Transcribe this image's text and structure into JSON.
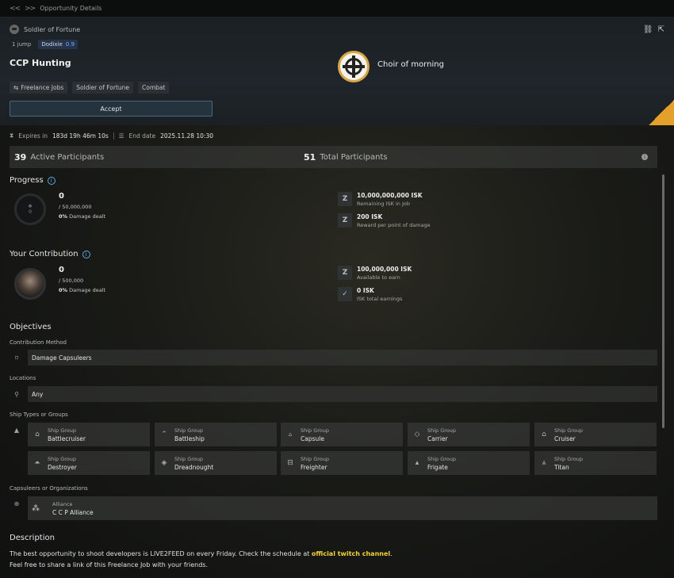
{
  "topbar": {
    "back": "<<",
    "forward": ">>",
    "title": "Opportunity Details"
  },
  "header": {
    "corporation": "Soldier of Fortune",
    "jumps": "1 jump",
    "system": "Dodixie",
    "security": "0.9",
    "job_title": "CCP Hunting",
    "tags": [
      "Freelance Jobs",
      "Soldier of Fortune",
      "Combat"
    ],
    "accept_label": "Accept",
    "organization": "Choir of morning",
    "icons": [
      "link-icon",
      "external-link-icon"
    ],
    "accent_color": "#e4a02b"
  },
  "expiry": {
    "expires_label": "Expires in",
    "expires_value": "183d 19h 46m 10s",
    "end_label": "End date",
    "end_value": "2025.11.28 10:30"
  },
  "participants": {
    "active_count": "39",
    "active_label": "Active Participants",
    "total_count": "51",
    "total_label": "Total Participants"
  },
  "progress": {
    "title": "Progress",
    "ring_value": "0",
    "current": "0",
    "target": "/ 50,000,000",
    "percent": "0%",
    "percent_label": "Damage dealt",
    "remaining_value": "10,000,000,000 ISK",
    "remaining_label": "Remaining ISK in Job",
    "reward_value": "200 ISK",
    "reward_label": "Reward per point of damage"
  },
  "contribution": {
    "title": "Your Contribution",
    "current": "0",
    "target": "/ 500,000",
    "percent": "0%",
    "percent_label": "Damage dealt",
    "available_value": "100,000,000 ISK",
    "available_label": "Available to earn",
    "earned_value": "0 ISK",
    "earned_label": "ISK total earnings"
  },
  "objectives": {
    "title": "Objectives",
    "method_label": "Contribution Method",
    "method_value": "Damage Capsuleers",
    "locations_label": "Locations",
    "locations_value": "Any",
    "ships_label": "Ship Types or Groups",
    "ship_group_label": "Ship Group",
    "ships": [
      "Battlecruiser",
      "Battleship",
      "Capsule",
      "Carrier",
      "Cruiser",
      "Destroyer",
      "Dreadnought",
      "Freighter",
      "Frigate",
      "Titan"
    ],
    "capsuleers_label": "Capsuleers or Organizations",
    "alliance_type": "Alliance",
    "alliance_name": "C C P Alliance"
  },
  "description": {
    "title": "Description",
    "line1_before": "The best opportunity to shoot developers is LIVE2FEED on every Friday. Check the schedule at ",
    "link": "official twitch channel",
    "line1_after": ".",
    "line2": "Feel free to share a link of this Freelance Job with your friends.",
    "link_color": "#f4d23a"
  }
}
